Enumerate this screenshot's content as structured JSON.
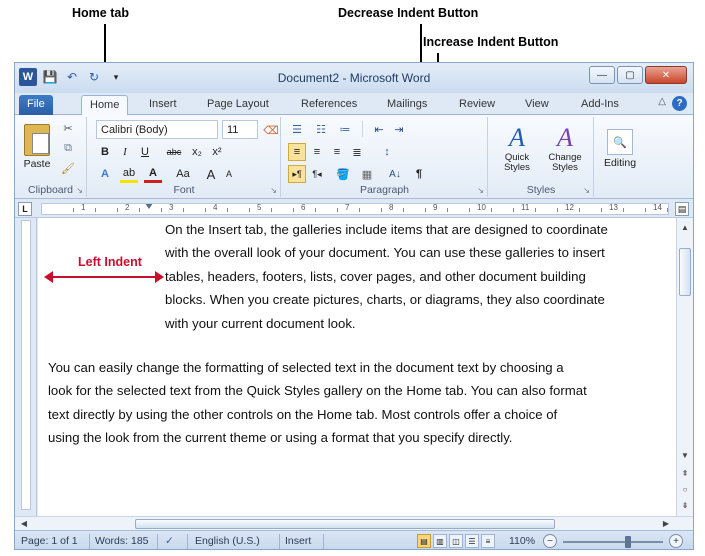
{
  "annotations": {
    "home_tab": "Home tab",
    "decrease_indent": "Decrease Indent Button",
    "increase_indent": "Increase Indent Button",
    "left_indent": "Left Indent"
  },
  "window": {
    "title": "Document2 - Microsoft Word",
    "controls": {
      "minimize": "—",
      "maximize": "▢",
      "close": "✕"
    }
  },
  "tabs": [
    "File",
    "Home",
    "Insert",
    "Page Layout",
    "References",
    "Mailings",
    "Review",
    "View",
    "Add-Ins"
  ],
  "active_tab": "Home",
  "ribbon": {
    "clipboard": {
      "label": "Clipboard",
      "paste": "Paste"
    },
    "font": {
      "label": "Font",
      "font_name": "Calibri (Body)",
      "font_size": "11",
      "bold": "B",
      "italic": "I",
      "underline": "U",
      "strike": "abc",
      "subscript": "x₂",
      "superscript": "x²",
      "grow": "A",
      "shrink": "A",
      "case": "Aa"
    },
    "paragraph": {
      "label": "Paragraph",
      "sort": "A↓",
      "pilcrow": "¶"
    },
    "styles": {
      "label": "Styles",
      "quick_styles": "Quick\nStyles",
      "change_styles": "Change\nStyles"
    },
    "editing": {
      "label": "Editing"
    }
  },
  "ruler": {
    "tab_selector": "L",
    "numbers": [
      "1",
      "2",
      "3",
      "4",
      "5",
      "6",
      "7",
      "8",
      "9",
      "10",
      "11",
      "12",
      "13",
      "14"
    ]
  },
  "document": {
    "paragraph1": "On the Insert tab, the galleries include items that are designed to coordinate\nwith the overall look of your document. You can use these galleries to insert\ntables, headers, footers, lists, cover pages, and other document building\nblocks. When you create pictures, charts, or diagrams, they also coordinate\nwith your current document look.",
    "paragraph2": "You can easily change the formatting of selected text in the document text by choosing a\nlook for the selected text from the Quick Styles gallery on the Home tab. You can also format\ntext directly by using the other controls on the Home tab. Most controls offer a choice of\nusing the look from the current theme or using a format that you specify directly."
  },
  "status": {
    "page": "Page: 1 of 1",
    "words": "Words: 185",
    "language": "English (U.S.)",
    "mode": "Insert",
    "zoom": "110%"
  }
}
